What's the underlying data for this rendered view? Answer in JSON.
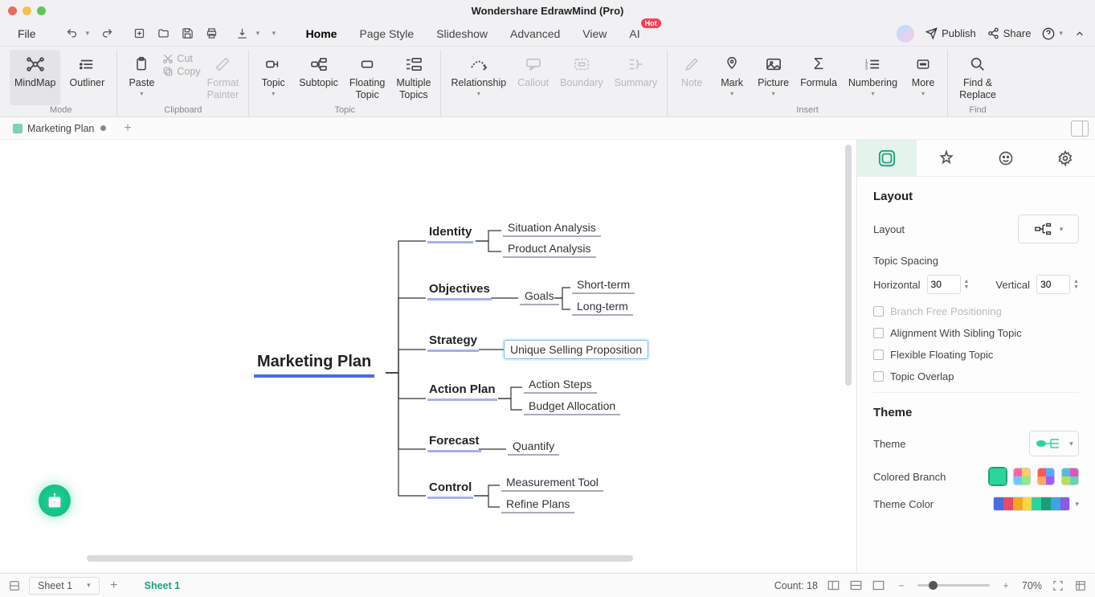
{
  "app_title": "Wondershare EdrawMind (Pro)",
  "menu": {
    "file": "File",
    "tabs": [
      "Home",
      "Page Style",
      "Slideshow",
      "Advanced",
      "View",
      "AI"
    ],
    "active_tab": "Home",
    "ai_badge": "Hot",
    "publish": "Publish",
    "share": "Share"
  },
  "ribbon": {
    "mode": {
      "mindmap": "MindMap",
      "outliner": "Outliner",
      "label": "Mode"
    },
    "clipboard": {
      "paste": "Paste",
      "cut": "Cut",
      "copy": "Copy",
      "format_painter": "Format\nPainter",
      "label": "Clipboard"
    },
    "topic": {
      "topic": "Topic",
      "subtopic": "Subtopic",
      "floating": "Floating\nTopic",
      "multiple": "Multiple\nTopics",
      "label": "Topic"
    },
    "relationship": "Relationship",
    "callout": "Callout",
    "boundary": "Boundary",
    "summary": "Summary",
    "insert": {
      "note": "Note",
      "mark": "Mark",
      "picture": "Picture",
      "formula": "Formula",
      "numbering": "Numbering",
      "more": "More",
      "label": "Insert"
    },
    "find": {
      "findreplace": "Find &\nReplace",
      "label": "Find"
    }
  },
  "doc_tab": "Marketing Plan",
  "mindmap": {
    "root": "Marketing Plan",
    "b1": "Identity",
    "b1l1": "Situation Analysis",
    "b1l2": "Product Analysis",
    "b2": "Objectives",
    "b2s": "Goals",
    "b2l1": "Short-term",
    "b2l2": "Long-term",
    "b3": "Strategy",
    "b3l1": "Unique Selling Proposition",
    "b4": "Action Plan",
    "b4l1": "Action Steps",
    "b4l2": "Budget Allocation",
    "b5": "Forecast",
    "b5l1": "Quantify",
    "b6": "Control",
    "b6l1": "Measurement Tool",
    "b6l2": "Refine Plans"
  },
  "panel": {
    "layout_h": "Layout",
    "layout_label": "Layout",
    "spacing_h": "Topic Spacing",
    "horizontal": "Horizontal",
    "h_val": "30",
    "vertical": "Vertical",
    "v_val": "30",
    "free_pos": "Branch Free Positioning",
    "align_sibling": "Alignment With Sibling Topic",
    "flex_float": "Flexible Floating Topic",
    "overlap": "Topic Overlap",
    "theme_h": "Theme",
    "theme_label": "Theme",
    "colored_branch": "Colored Branch",
    "theme_color": "Theme Color"
  },
  "status": {
    "sheet_dd": "Sheet 1",
    "sheet_active": "Sheet 1",
    "count": "Count: 18",
    "zoom": "70%"
  }
}
